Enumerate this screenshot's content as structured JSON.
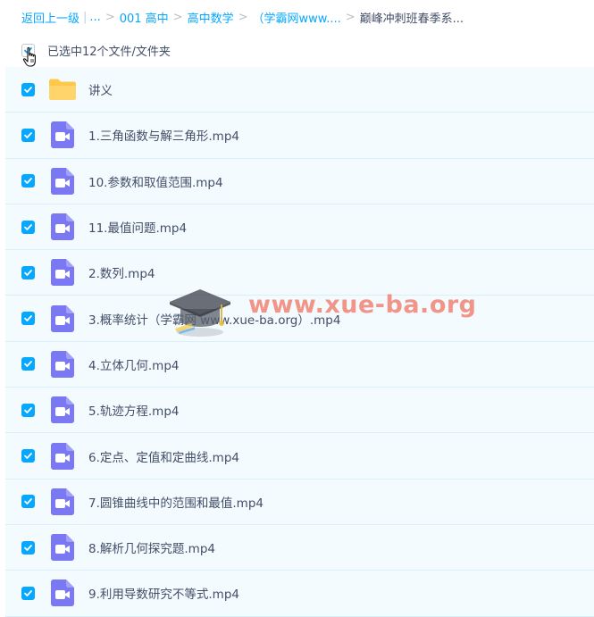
{
  "breadcrumb": {
    "back": "返回上一级",
    "bar": "|",
    "ellipsis": "...",
    "sep": ">",
    "items": [
      "001 高中",
      "高中数学",
      "（学霸网www...."
    ],
    "current": "巅峰冲刺班春季系..."
  },
  "selection": {
    "text": "已选中12个文件/文件夹"
  },
  "files": [
    {
      "name": "讲义",
      "type": "folder-icon"
    },
    {
      "name": "1.三角函数与解三角形.mp4",
      "type": "video-file-icon"
    },
    {
      "name": "10.参数和取值范围.mp4",
      "type": "video-file-icon"
    },
    {
      "name": "11.最值问题.mp4",
      "type": "video-file-icon"
    },
    {
      "name": "2.数列.mp4",
      "type": "video-file-icon"
    },
    {
      "name": "3.概率统计（学霸网 www.xue-ba.org）.mp4",
      "type": "video-file-icon"
    },
    {
      "name": "4.立体几何.mp4",
      "type": "video-file-icon"
    },
    {
      "name": "5.轨迹方程.mp4",
      "type": "video-file-icon"
    },
    {
      "name": "6.定点、定值和定曲线.mp4",
      "type": "video-file-icon"
    },
    {
      "name": "7.圆锥曲线中的范围和最值.mp4",
      "type": "video-file-icon"
    },
    {
      "name": "8.解析几何探究题.mp4",
      "type": "video-file-icon"
    },
    {
      "name": "9.利用导数研究不等式.mp4",
      "type": "video-file-icon"
    }
  ],
  "watermark": {
    "text": "www.xue-ba.org",
    "icon": "graduation-cap-icon"
  },
  "colors": {
    "accent": "#06a7ff",
    "video_icon": "#7a78f2",
    "folder": "#ffc84a",
    "row_bg": "#f4fbff",
    "text": "#424e67"
  }
}
